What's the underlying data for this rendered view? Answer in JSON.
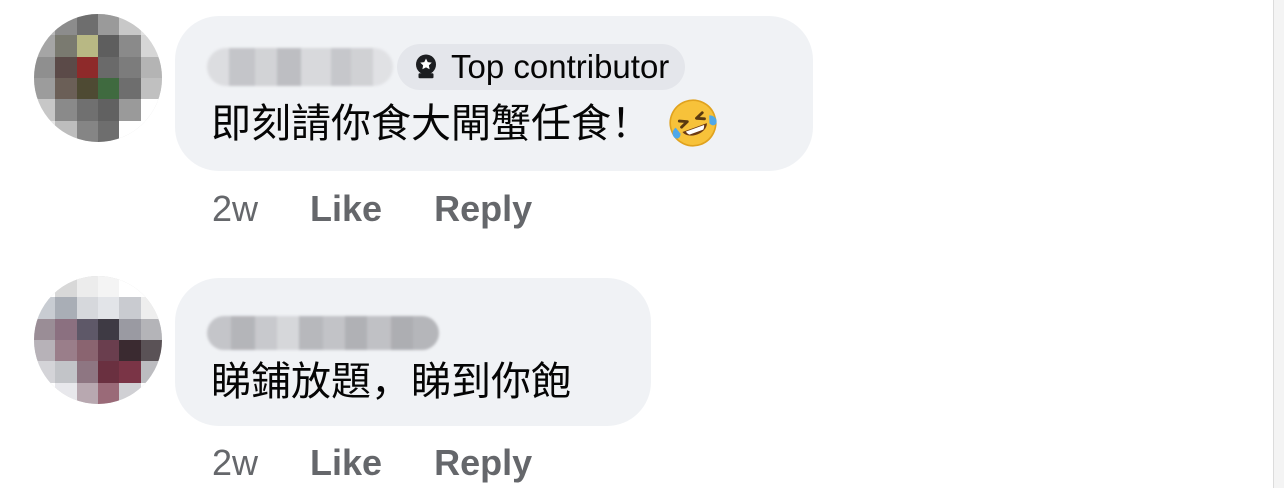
{
  "comments": [
    {
      "badge_label": "Top contributor",
      "badge_icon": "award-badge-icon",
      "text": "即刻請你食大閘蟹任食！",
      "emoji": "rolling-on-floor-laughing",
      "time": "2w",
      "like_label": "Like",
      "reply_label": "Reply"
    },
    {
      "text": "睇鋪放題，睇到你飽",
      "time": "2w",
      "like_label": "Like",
      "reply_label": "Reply"
    }
  ],
  "colors": {
    "bubble": "#f0f2f5",
    "badge": "#e4e6eb",
    "meta_text": "#65676b",
    "main_text": "#050505"
  }
}
